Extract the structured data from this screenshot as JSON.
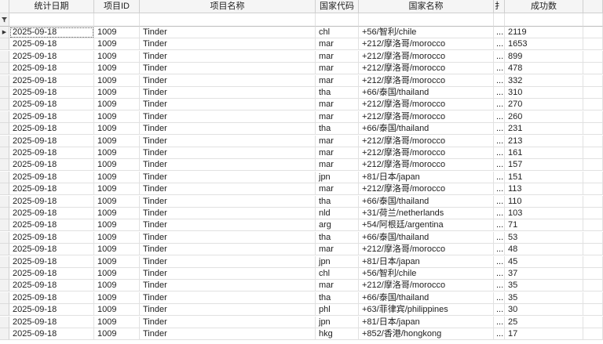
{
  "grid": {
    "columns": [
      "统计日期",
      "项目ID",
      "项目名称",
      "国家代码",
      "国家名称",
      "扌",
      "成功数"
    ],
    "filter_icon": "filter-funnel-icon",
    "current_row_icon": "current-row-arrow-icon",
    "rows": [
      [
        "2025-09-18",
        "1009",
        "Tinder",
        "chl",
        "+56/智利/chile",
        "...",
        "2119"
      ],
      [
        "2025-09-18",
        "1009",
        "Tinder",
        "mar",
        "+212/摩洛哥/morocco",
        "...",
        "1653"
      ],
      [
        "2025-09-18",
        "1009",
        "Tinder",
        "mar",
        "+212/摩洛哥/morocco",
        "...",
        "899"
      ],
      [
        "2025-09-18",
        "1009",
        "Tinder",
        "mar",
        "+212/摩洛哥/morocco",
        "...",
        "478"
      ],
      [
        "2025-09-18",
        "1009",
        "Tinder",
        "mar",
        "+212/摩洛哥/morocco",
        "...",
        "332"
      ],
      [
        "2025-09-18",
        "1009",
        "Tinder",
        "tha",
        "+66/泰国/thailand",
        "...",
        "310"
      ],
      [
        "2025-09-18",
        "1009",
        "Tinder",
        "mar",
        "+212/摩洛哥/morocco",
        "...",
        "270"
      ],
      [
        "2025-09-18",
        "1009",
        "Tinder",
        "mar",
        "+212/摩洛哥/morocco",
        "...",
        "260"
      ],
      [
        "2025-09-18",
        "1009",
        "Tinder",
        "tha",
        "+66/泰国/thailand",
        "...",
        "231"
      ],
      [
        "2025-09-18",
        "1009",
        "Tinder",
        "mar",
        "+212/摩洛哥/morocco",
        "...",
        "213"
      ],
      [
        "2025-09-18",
        "1009",
        "Tinder",
        "mar",
        "+212/摩洛哥/morocco",
        "...",
        "161"
      ],
      [
        "2025-09-18",
        "1009",
        "Tinder",
        "mar",
        "+212/摩洛哥/morocco",
        "...",
        "157"
      ],
      [
        "2025-09-18",
        "1009",
        "Tinder",
        "jpn",
        "+81/日本/japan",
        "...",
        "151"
      ],
      [
        "2025-09-18",
        "1009",
        "Tinder",
        "mar",
        "+212/摩洛哥/morocco",
        "...",
        "113"
      ],
      [
        "2025-09-18",
        "1009",
        "Tinder",
        "tha",
        "+66/泰国/thailand",
        "...",
        "110"
      ],
      [
        "2025-09-18",
        "1009",
        "Tinder",
        "nld",
        "+31/荷兰/netherlands",
        "...",
        "103"
      ],
      [
        "2025-09-18",
        "1009",
        "Tinder",
        "arg",
        "+54/阿根廷/argentina",
        "...",
        "71"
      ],
      [
        "2025-09-18",
        "1009",
        "Tinder",
        "tha",
        "+66/泰国/thailand",
        "...",
        "53"
      ],
      [
        "2025-09-18",
        "1009",
        "Tinder",
        "mar",
        "+212/摩洛哥/morocco",
        "...",
        "48"
      ],
      [
        "2025-09-18",
        "1009",
        "Tinder",
        "jpn",
        "+81/日本/japan",
        "...",
        "45"
      ],
      [
        "2025-09-18",
        "1009",
        "Tinder",
        "chl",
        "+56/智利/chile",
        "...",
        "37"
      ],
      [
        "2025-09-18",
        "1009",
        "Tinder",
        "mar",
        "+212/摩洛哥/morocco",
        "...",
        "35"
      ],
      [
        "2025-09-18",
        "1009",
        "Tinder",
        "tha",
        "+66/泰国/thailand",
        "...",
        "35"
      ],
      [
        "2025-09-18",
        "1009",
        "Tinder",
        "phl",
        "+63/菲律宾/philippines",
        "...",
        "30"
      ],
      [
        "2025-09-18",
        "1009",
        "Tinder",
        "jpn",
        "+81/日本/japan",
        "...",
        "25"
      ],
      [
        "2025-09-18",
        "1009",
        "Tinder",
        "hkg",
        "+852/香港/hongkong",
        "...",
        "17"
      ]
    ]
  }
}
